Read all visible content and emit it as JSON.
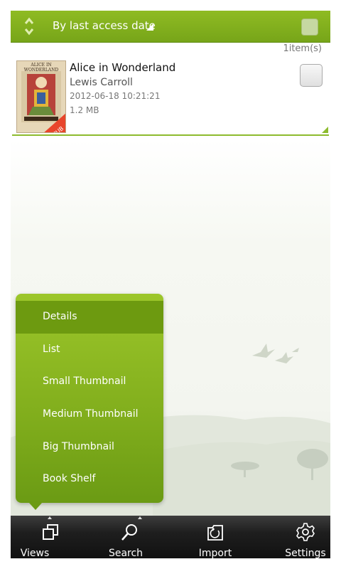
{
  "sort_bar": {
    "label": "By last access date",
    "icon": "sort-updown-icon",
    "accent": "#86b41f"
  },
  "count_text": "1item(s)",
  "book": {
    "title": "Alice in Wonderland",
    "author": "Lewis Carroll",
    "date": "2012-06-18 10:21:21",
    "size": "1.2 MB",
    "cover_title": "ALICE IN WONDERLAND",
    "badge": "EPUB"
  },
  "views_menu": {
    "items": [
      {
        "label": "Details",
        "selected": true
      },
      {
        "label": "List"
      },
      {
        "label": "Small Thumbnail"
      },
      {
        "label": "Medium Thumbnail"
      },
      {
        "label": "Big Thumbnail"
      },
      {
        "label": "Book Shelf"
      }
    ]
  },
  "toolbar": {
    "items": [
      {
        "label": "Views",
        "icon": "views-icon"
      },
      {
        "label": "Search",
        "icon": "search-icon"
      },
      {
        "label": "Import",
        "icon": "import-icon"
      },
      {
        "label": "Settings",
        "icon": "gear-icon"
      }
    ]
  }
}
